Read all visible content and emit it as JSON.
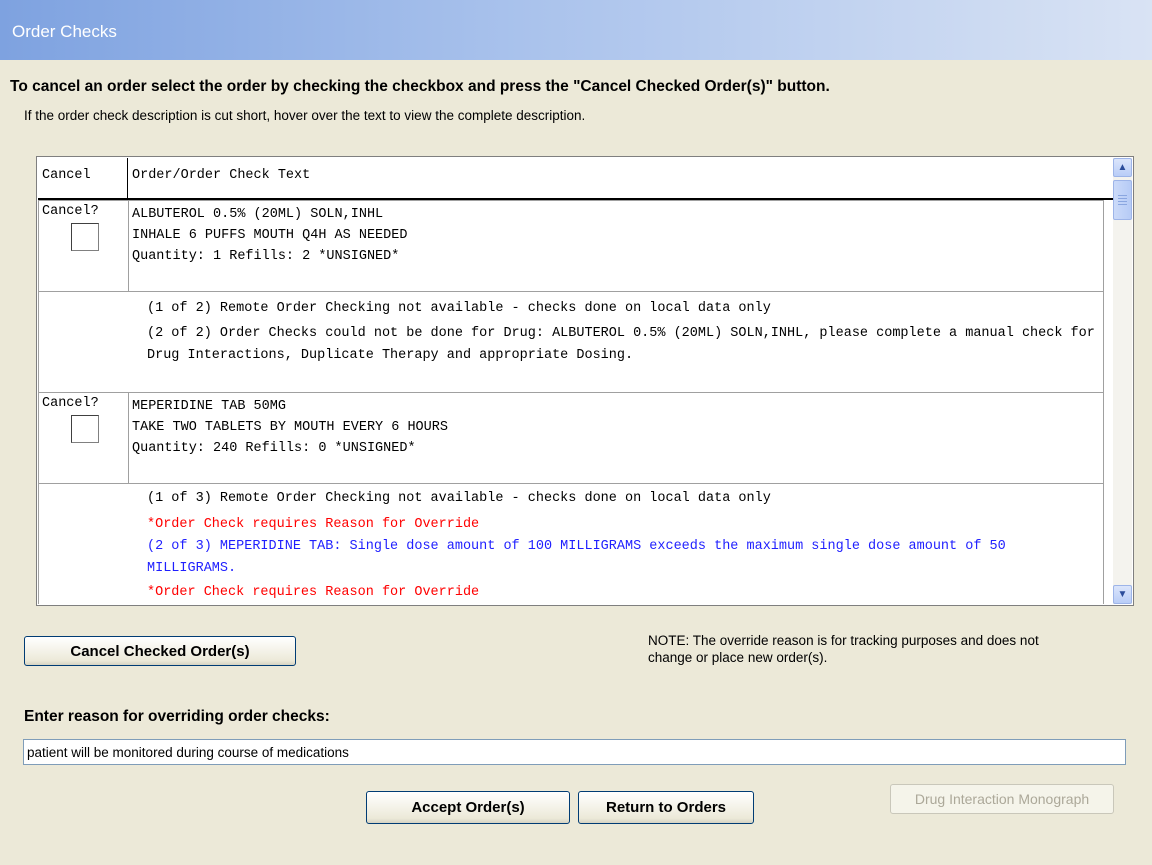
{
  "window": {
    "title": "Order Checks"
  },
  "instructions": {
    "main": "To cancel an order select the order by checking the checkbox and press the \"Cancel Checked Order(s)\" button.",
    "hint": "If the order check description is cut short, hover over the text to view the complete description."
  },
  "grid": {
    "columns": [
      "Cancel",
      "Order/Order Check Text"
    ],
    "orders": [
      {
        "cancel_label": "Cancel?",
        "checked": false,
        "lines": [
          "ALBUTEROL 0.5% (20ML) SOLN,INHL",
          "INHALE 6 PUFFS MOUTH Q4H AS NEEDED",
          "Quantity: 1 Refills: 2 *UNSIGNED*"
        ],
        "checks": [
          {
            "color": "#000000",
            "text": "(1 of 2)  Remote Order Checking not available - checks done on local data only"
          },
          {
            "color": "#000000",
            "text": "(2 of 2)  Order Checks could not be done for Drug: ALBUTEROL 0.5% (20ML) SOLN,INHL, please complete a manual check for Drug Interactions, Duplicate Therapy and appropriate Dosing."
          }
        ]
      },
      {
        "cancel_label": "Cancel?",
        "checked": false,
        "lines": [
          "MEPERIDINE TAB 50MG",
          "TAKE TWO TABLETS BY MOUTH EVERY 6 HOURS",
          "Quantity: 240 Refills: 0 *UNSIGNED*"
        ],
        "checks": [
          {
            "color": "#000000",
            "text": "(1 of 3)  Remote Order Checking not available - checks done on local data only"
          },
          {
            "color": "#ff0000",
            "text": "*Order Check requires Reason for Override"
          },
          {
            "color": "#1f1fff",
            "text": "(2 of 3)  MEPERIDINE TAB: Single dose amount of 100 MILLIGRAMS exceeds the maximum single dose amount of 50 MILLIGRAMS."
          },
          {
            "color": "#ff0000",
            "text": "*Order Check requires Reason for Override"
          }
        ]
      }
    ]
  },
  "buttons": {
    "cancel_checked": "Cancel Checked Order(s)",
    "accept": "Accept Order(s)",
    "return": "Return to Orders",
    "monograph": "Drug Interaction Monograph"
  },
  "note": "NOTE: The override reason is for tracking purposes and does not change or place new order(s).",
  "override": {
    "label": "Enter reason for overriding order checks:",
    "value": "patient will be monitored during course of medications"
  }
}
